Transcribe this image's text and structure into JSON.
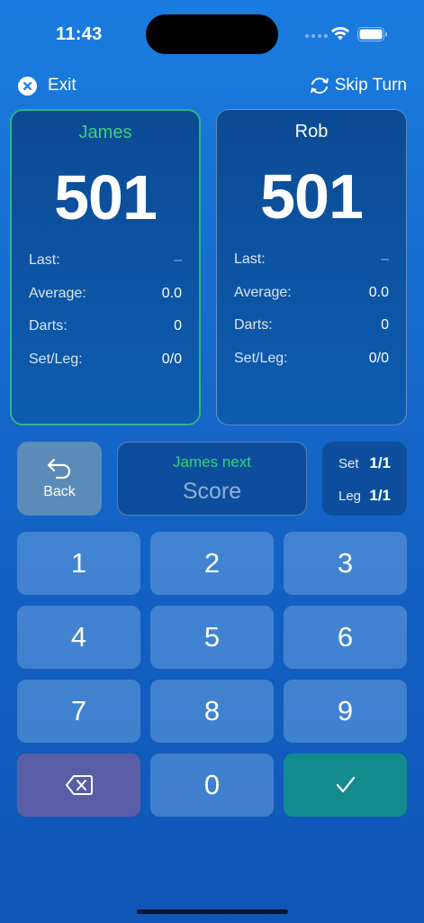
{
  "status_bar": {
    "time": "11:43"
  },
  "nav": {
    "exit_label": "Exit",
    "skip_label": "Skip Turn",
    "exit_icon": "close-circle-icon",
    "skip_icon": "refresh-icon"
  },
  "players": [
    {
      "name": "James",
      "score": "501",
      "active": true,
      "stats": {
        "last_label": "Last:",
        "last_value": "–",
        "average_label": "Average:",
        "average_value": "0.0",
        "darts_label": "Darts:",
        "darts_value": "0",
        "setleg_label": "Set/Leg:",
        "setleg_value": "0/0"
      }
    },
    {
      "name": "Rob",
      "score": "501",
      "active": false,
      "stats": {
        "last_label": "Last:",
        "last_value": "–",
        "average_label": "Average:",
        "average_value": "0.0",
        "darts_label": "Darts:",
        "darts_value": "0",
        "setleg_label": "Set/Leg:",
        "setleg_value": "0/0"
      }
    }
  ],
  "controls": {
    "back_label": "Back",
    "back_icon": "undo-arrow-icon",
    "next_player_label": "James next",
    "score_placeholder": "Score",
    "set_label": "Set",
    "set_value": "1/1",
    "leg_label": "Leg",
    "leg_value": "1/1"
  },
  "keypad": {
    "k1": "1",
    "k2": "2",
    "k3": "3",
    "k4": "4",
    "k5": "5",
    "k6": "6",
    "k7": "7",
    "k8": "8",
    "k9": "9",
    "k0": "0",
    "delete_icon": "backspace-icon",
    "confirm_icon": "checkmark-icon"
  },
  "colors": {
    "active_player": "#36d27a",
    "active_border": "#2ab58a",
    "delete_key": "#5a5ea6",
    "confirm_key": "#138a8e"
  }
}
